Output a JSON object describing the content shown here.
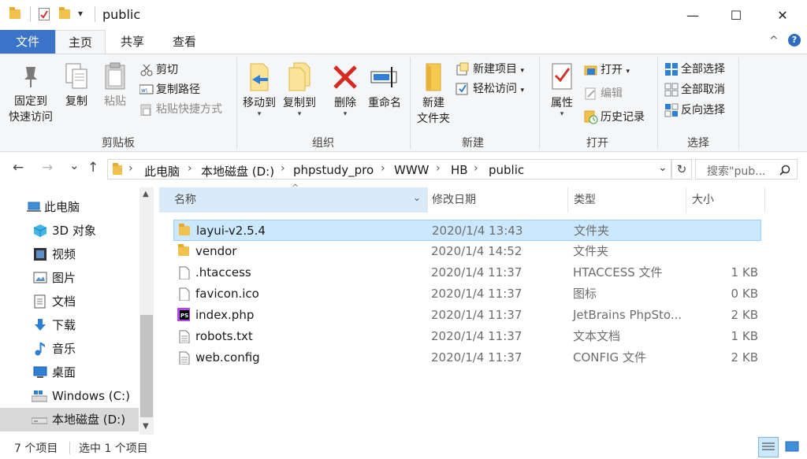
{
  "window": {
    "title": "public",
    "controls": {
      "minimize": "—",
      "maximize": "☐",
      "close": "✕"
    }
  },
  "quick_access": {
    "dropdown": "▾"
  },
  "ribbon_tabs": [
    {
      "label": "文件"
    },
    {
      "label": "主页"
    },
    {
      "label": "共享"
    },
    {
      "label": "查看"
    }
  ],
  "ribbon": {
    "expand_icon": "^",
    "help_icon": "?",
    "clipboard": {
      "label": "剪贴板",
      "pin_line1": "固定到",
      "pin_line2": "快速访问",
      "copy": "复制",
      "paste": "粘贴",
      "cut": "剪切",
      "copy_path": "复制路径",
      "paste_shortcut": "粘贴快捷方式"
    },
    "organize": {
      "label": "组织",
      "move_to": "移动到",
      "copy_to": "复制到",
      "delete": "删除",
      "rename": "重命名"
    },
    "new": {
      "label": "新建",
      "new_folder_line1": "新建",
      "new_folder_line2": "文件夹",
      "new_item": "新建项目",
      "easy_access": "轻松访问"
    },
    "open": {
      "label": "打开",
      "properties": "属性",
      "open": "打开",
      "edit": "编辑",
      "history": "历史记录"
    },
    "select": {
      "label": "选择",
      "select_all": "全部选择",
      "select_none": "全部取消",
      "invert": "反向选择"
    }
  },
  "address": {
    "back": "←",
    "forward": "→",
    "recent": "⌄",
    "up": "↑",
    "breadcrumbs": [
      "此电脑",
      "本地磁盘 (D:)",
      "phpstudy_pro",
      "WWW",
      "HB",
      "public"
    ],
    "separator": "›",
    "search_placeholder": "搜索\"pub...",
    "refresh": "↻"
  },
  "nav_pane": {
    "items": [
      {
        "label": "此电脑",
        "icon": "computer-icon"
      },
      {
        "label": "3D 对象",
        "icon": "3d-objects-icon"
      },
      {
        "label": "视频",
        "icon": "video-icon"
      },
      {
        "label": "图片",
        "icon": "pictures-icon"
      },
      {
        "label": "文档",
        "icon": "documents-icon"
      },
      {
        "label": "下载",
        "icon": "downloads-icon"
      },
      {
        "label": "音乐",
        "icon": "music-icon"
      },
      {
        "label": "桌面",
        "icon": "desktop-icon"
      },
      {
        "label": "Windows (C:)",
        "icon": "windows-drive-icon"
      },
      {
        "label": "本地磁盘 (D:)",
        "icon": "drive-icon"
      }
    ]
  },
  "columns": {
    "name": "名称",
    "date": "修改日期",
    "type": "类型",
    "size": "大小"
  },
  "files": [
    {
      "name": "layui-v2.5.4",
      "date": "2020/1/4 13:43",
      "type": "文件夹",
      "size": "",
      "icon": "folder-icon"
    },
    {
      "name": "vendor",
      "date": "2020/1/4 14:52",
      "type": "文件夹",
      "size": "",
      "icon": "folder-icon"
    },
    {
      "name": ".htaccess",
      "date": "2020/1/4 11:37",
      "type": "HTACCESS 文件",
      "size": "1 KB",
      "icon": "file-icon"
    },
    {
      "name": "favicon.ico",
      "date": "2020/1/4 11:37",
      "type": "图标",
      "size": "0 KB",
      "icon": "file-icon"
    },
    {
      "name": "index.php",
      "date": "2020/1/4 11:37",
      "type": "JetBrains PhpSto...",
      "size": "2 KB",
      "icon": "phpstorm-icon"
    },
    {
      "name": "robots.txt",
      "date": "2020/1/4 11:37",
      "type": "文本文档",
      "size": "1 KB",
      "icon": "text-file-icon"
    },
    {
      "name": "web.config",
      "date": "2020/1/4 11:37",
      "type": "CONFIG 文件",
      "size": "2 KB",
      "icon": "config-file-icon"
    }
  ],
  "status": {
    "count": "7 个项目",
    "selected": "选中 1 个项目"
  },
  "colors": {
    "accent": "#3a73c7",
    "selection": "#cce8ff",
    "folder": "#f2c14b"
  }
}
